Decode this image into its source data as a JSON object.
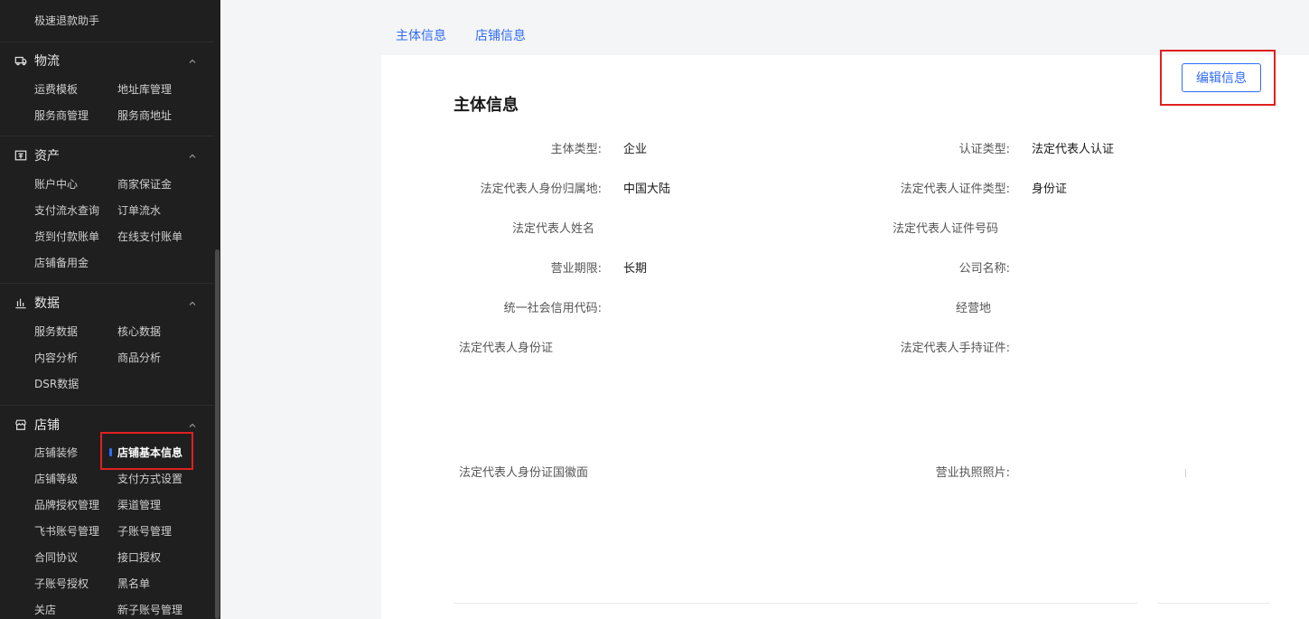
{
  "sidebar": {
    "top_item": "极速退款助手",
    "sections": [
      {
        "title": "物流",
        "icon": "truck-icon",
        "items": [
          "运费模板",
          "地址库管理",
          "服务商管理",
          "服务商地址"
        ]
      },
      {
        "title": "资产",
        "icon": "wallet-icon",
        "items": [
          "账户中心",
          "商家保证金",
          "支付流水查询",
          "订单流水",
          "货到付款账单",
          "在线支付账单",
          "店铺备用金"
        ]
      },
      {
        "title": "数据",
        "icon": "bar-chart-icon",
        "items": [
          "服务数据",
          "核心数据",
          "内容分析",
          "商品分析",
          "DSR数据"
        ]
      },
      {
        "title": "店铺",
        "icon": "store-icon",
        "items": [
          "店铺装修",
          "店铺基本信息",
          "店铺等级",
          "支付方式设置",
          "品牌授权管理",
          "渠道管理",
          "飞书账号管理",
          "子账号管理",
          "合同协议",
          "接口授权",
          "子账号授权",
          "黑名单",
          "关店",
          "新子账号管理"
        ]
      }
    ],
    "active_item": "店铺基本信息"
  },
  "tabs": [
    "主体信息",
    "店铺信息"
  ],
  "panel": {
    "edit_button": "编辑信息",
    "title": "主体信息",
    "fields": [
      {
        "label": "主体类型:",
        "value": "企业"
      },
      {
        "label": "认证类型:",
        "value": "法定代表人认证"
      },
      {
        "label": "法定代表人身份归属地:",
        "value": "中国大陆"
      },
      {
        "label": "法定代表人证件类型:",
        "value": "身份证"
      },
      {
        "label": "法定代表人姓名",
        "value": ""
      },
      {
        "label": "法定代表人证件号码",
        "value": ""
      },
      {
        "label": "营业期限:",
        "value": "长期"
      },
      {
        "label": "公司名称:",
        "value": ""
      },
      {
        "label": "统一社会信用代码:",
        "value": ""
      },
      {
        "label": "经营地",
        "value": ""
      },
      {
        "label": "法定代表人身份证",
        "value": ""
      },
      {
        "label": "法定代表人手持证件:",
        "value": ""
      },
      {
        "label": "法定代表人身份证国徽面",
        "value": ""
      },
      {
        "label": "营业执照照片:",
        "value": ""
      }
    ]
  },
  "colors": {
    "accent": "#2f6cf6",
    "sidebar_bg": "#1f1f1f",
    "highlight_border": "#e02020"
  }
}
